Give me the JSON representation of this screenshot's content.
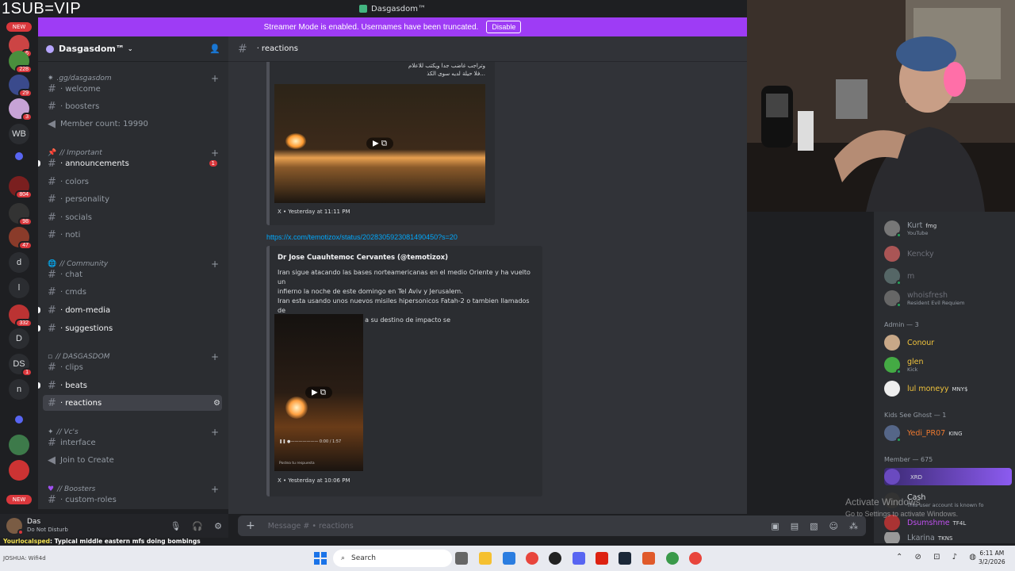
{
  "overlay": {
    "sub_text": "1SUB=VIP"
  },
  "window": {
    "title": "Dasgasdom™"
  },
  "banner": {
    "text": "Streamer Mode is enabled. Usernames have been truncated.",
    "button": "Disable"
  },
  "rail": {
    "new_top": "NEW",
    "new_bottom": "NEW",
    "labels": [
      "WB",
      "d",
      "l",
      "D",
      "DS",
      "n"
    ],
    "badges": [
      "6",
      "228",
      "29",
      "3",
      "804",
      "98",
      "47",
      "332",
      "1"
    ]
  },
  "sidebar": {
    "guild_name": "Dasgasdom™",
    "categories": [
      {
        "label": ".gg/dasgasdom"
      },
      {
        "label": "// Important"
      },
      {
        "label": "// Community"
      },
      {
        "label": "// DASGASDOM"
      },
      {
        "label": "// Vc's"
      },
      {
        "label": "// Boosters"
      }
    ],
    "channels": {
      "welcome": "welcome",
      "boosters": "boosters",
      "member_count": "Member count: 19990",
      "announcements": "announcements",
      "announcements_badge": "1",
      "colors": "colors",
      "personality": "personality",
      "socials": "socials",
      "noti": "noti",
      "chat": "chat",
      "cmds": "cmds",
      "dom_media": "dom-media",
      "suggestions": "suggestions",
      "clips": "clips",
      "beats": "beats",
      "reactions": "reactions",
      "interface": "interface",
      "join_to_create": "Join to Create",
      "custom_roles": "custom-roles"
    }
  },
  "user_panel": {
    "name": "Das",
    "status": "Do Not Disturb"
  },
  "chat": {
    "channel": "reactions",
    "embed1": {
      "arabic_line1": "وتراجب غاضب جدا ويكتب للاعلام",
      "arabic_line2": "فلا حيلة لديه سوى الكذ...",
      "footer": "X • Yesterday at 11:11 PM"
    },
    "link": "https://x.com/temotizox/status/2028305923081490450?s=20",
    "embed2": {
      "author": "Dr Jose Cuauhtemoc Cervantes (@temotizox)",
      "body_line1": "Iran sigue atacando las bases norteamericanas en el medio Oriente y ha vuelto un",
      "body_line2": "infierno la noche de este domingo en Tel Aviv y Jerusalem.",
      "body_line3": "Iran esta usando unos nuevos misiles hipersonicos Fatah-2 o tambien llamados de",
      "body_line4": "racimo que antes de llegar a su destino de impacto se",
      "video_time": "0:00 / 1:57",
      "video_reply": "Postea tu respuesta",
      "footer": "X • Yesterday at 10:06 PM"
    },
    "composer_placeholder": "Message # • reactions"
  },
  "members": {
    "top_rows": [
      {
        "name": "Kurt",
        "tag": "fmg",
        "sub": "YouTube"
      },
      {
        "name": "Kencky",
        "tag": "",
        "sub": ""
      },
      {
        "name": "m",
        "tag": "",
        "sub": ""
      },
      {
        "name": "whoisfresh",
        "tag": "",
        "sub": "Resident Evil Requiem"
      }
    ],
    "admin_header": "Admin — 3",
    "admins": [
      {
        "name": "Conour",
        "tag": "",
        "sub": ""
      },
      {
        "name": "glen",
        "tag": "",
        "sub": "Kick"
      },
      {
        "name": "lul moneyy",
        "tag": "MNY$",
        "sub": ""
      }
    ],
    "kids_header": "Kids See Ghost — 1",
    "kids": [
      {
        "name": "Yedi_PR07",
        "tag": "KING",
        "sub": ""
      }
    ],
    "member_header": "Member — 675",
    "member_rows": [
      {
        "name": "",
        "tag": "XRD",
        "sub": ""
      },
      {
        "name": "Cash",
        "tag": "",
        "sub": "This user account is known fo"
      },
      {
        "name": "Dsumshme",
        "tag": "TF4L",
        "sub": ""
      },
      {
        "name": "Lkarina",
        "tag": "TKNS",
        "sub": ""
      }
    ]
  },
  "watermark": {
    "line1": "Activate Windows",
    "line2": "Go to Settings to activate Windows."
  },
  "ticker": {
    "name": "Yourlocalsped",
    "message": ": Typical middle eastern mfs doing bombings"
  },
  "taskbar": {
    "search": "Search",
    "time": "6:11 AM",
    "date": "3/2/2026",
    "left_text": "JOSHUA: Wifi4d"
  },
  "colors": {
    "accent": "#9e3cf5",
    "link": "#00a8fc",
    "admin_name": "#f0c33c",
    "king_name": "#f07a2f"
  }
}
